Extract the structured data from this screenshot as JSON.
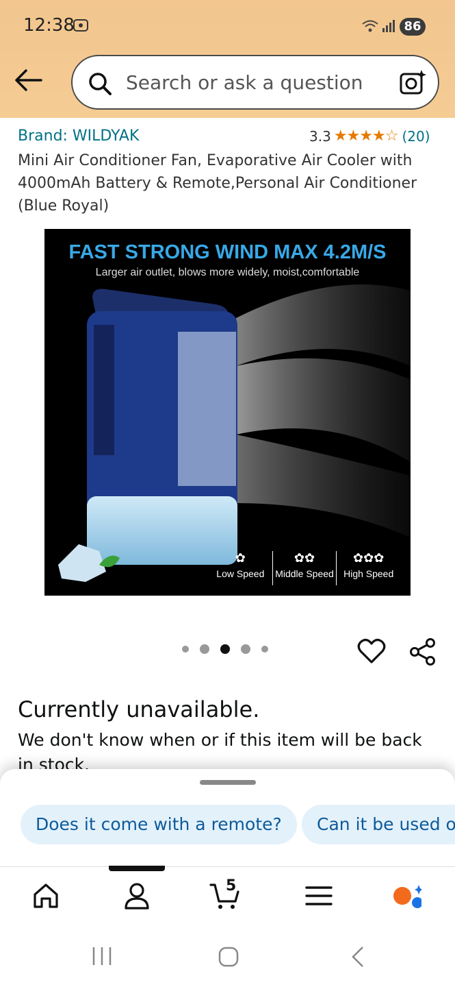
{
  "status": {
    "time": "12:38",
    "battery": "86"
  },
  "search": {
    "placeholder": "Search or ask a question"
  },
  "product": {
    "brand": "Brand: WILDYAK",
    "rating": "3.3",
    "stars": "★★★★☆",
    "review_count": "(20)",
    "title": "Mini Air Conditioner Fan, Evaporative Air Cooler with 4000mAh Battery & Remote,Personal Air Conditioner (Blue Royal)"
  },
  "image": {
    "headline": "FAST STRONG WIND MAX 4.2M/S",
    "subline": "Larger air outlet, blows more widely, moist,comfortable",
    "speeds": [
      "Low Speed",
      "Middle Speed",
      "High Speed"
    ],
    "fan_glyphs": [
      "✿",
      "✿✿",
      "✿✿✿"
    ]
  },
  "availability": {
    "heading": "Currently unavailable.",
    "detail": "We don't know when or if this item will be back in stock."
  },
  "chips": [
    "Does it come with a remote?",
    "Can it be used o"
  ],
  "nav": {
    "cart_count": "5"
  },
  "colors": {
    "header": "#f2c68e",
    "link": "#007185",
    "star": "#e67a00",
    "chip_bg": "#e3f1fb"
  }
}
